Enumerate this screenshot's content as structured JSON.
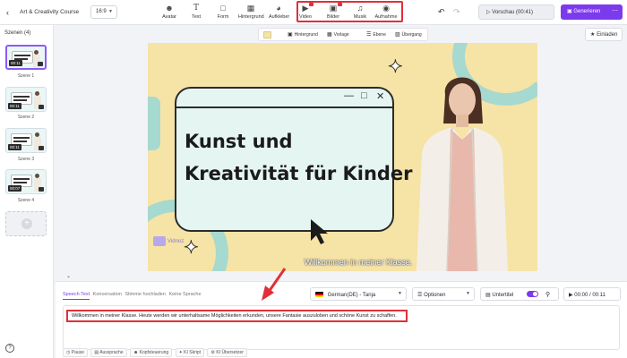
{
  "app": {
    "project_title": "Art & Creativity Course",
    "aspect_ratio": "16:9"
  },
  "toolbar": {
    "tools": [
      {
        "label": "Avatar",
        "icon": "avatar-icon"
      },
      {
        "label": "Text",
        "icon": "text-icon"
      },
      {
        "label": "Form",
        "icon": "shape-icon"
      },
      {
        "label": "Hintergrund",
        "icon": "background-icon"
      },
      {
        "label": "Aufkleber",
        "icon": "sticker-icon"
      },
      {
        "label": "Video",
        "icon": "video-icon"
      },
      {
        "label": "Bilder",
        "icon": "image-icon"
      },
      {
        "label": "Musik",
        "icon": "music-icon"
      },
      {
        "label": "Aufnahme",
        "icon": "record-icon"
      }
    ],
    "preview_label": "Vorschau (00:41)",
    "generate_label": "Generieren"
  },
  "sidebar": {
    "title": "Szenen (4)",
    "scenes": [
      {
        "label": "Szene 1",
        "time": "00:11"
      },
      {
        "label": "Szene 2",
        "time": "00:11"
      },
      {
        "label": "Szene 3",
        "time": "00:11"
      },
      {
        "label": "Szene 4",
        "time": "00:07"
      }
    ]
  },
  "canvas_toolbar": {
    "background_label": "Hintergrund",
    "template_label": "Vorlage",
    "layer_label": "Ebene",
    "transition_label": "Übergang",
    "invite_label": "Einladen",
    "swatch_color": "#f6e3a6"
  },
  "canvas": {
    "headline_line1": "Kunst und",
    "headline_line2": "Kreativität für Kinder",
    "subtitle": "Willkommen in meiner Klasse.",
    "logo_text": "Vidnoz",
    "bg_color": "#f6e3a6",
    "accent_color": "#a6d9cf"
  },
  "bottom": {
    "tabs": [
      "Speech Text",
      "Konversation",
      "Stimme hochladen",
      "Keine Sprache"
    ],
    "voice": "German(DE) - Tanja",
    "options_label": "Optionen",
    "subtitles_label": "Untertitel",
    "time_display": "00:00 / 00:11",
    "script_text": "Willkommen in meiner Klasse. Heute werden wir unterhaltsame Möglichkeiten erkunden, unsere Fantasie auszuloben und schöne Kunst zu schaffen.",
    "tools": [
      "Pause",
      "Aussprache",
      "Kopfsteuerung",
      "KI Skript",
      "KI Übersetzer"
    ]
  },
  "colors": {
    "accent": "#7c3aed",
    "highlight": "#e0303a"
  }
}
